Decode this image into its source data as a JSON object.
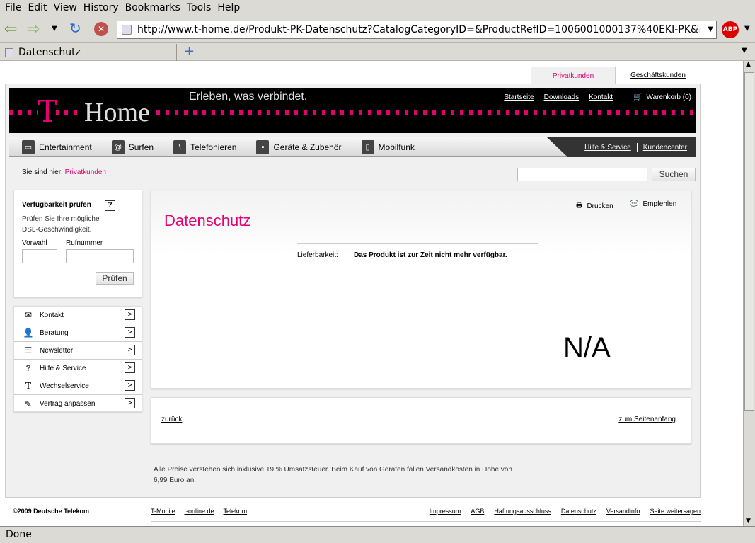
{
  "browser": {
    "menu": [
      "File",
      "Edit",
      "View",
      "History",
      "Bookmarks",
      "Tools",
      "Help"
    ],
    "url": "http://www.t-home.de/Produkt-PK-Datenschutz?CatalogCategoryID=&ProductRefID=1006001000137%40EKI-PK&",
    "tab_title": "Datenschutz",
    "status": "Done",
    "adblock": "ABP"
  },
  "site": {
    "tabs": [
      "Privatkunden",
      "Geschäftskunden"
    ],
    "logo_t": "T",
    "logo_home": "Home",
    "slogan": "Erleben, was verbindet.",
    "top_links": [
      "Startseite",
      "Downloads",
      "Kontakt"
    ],
    "cart": "Warenkorb (0)",
    "nav": [
      "Entertainment",
      "Surfen",
      "Telefonieren",
      "Geräte & Zubehör",
      "Mobilfunk"
    ],
    "nav_right": [
      "Hilfe & Service",
      "Kundencenter"
    ],
    "breadcrumb_label": "Sie sind hier:",
    "breadcrumb_item": "Privatkunden",
    "search_button": "Suchen",
    "search_value": "",
    "check": {
      "title": "Verfügbarkeit prüfen",
      "help": "?",
      "desc1": "Prüfen Sie Ihre mögliche",
      "desc2": "DSL-Geschwindigkeit.",
      "label_vorwahl": "Vorwahl",
      "label_rufnummer": "Rufnummer",
      "button": "Prüfen"
    },
    "links": [
      "Kontakt",
      "Beratung",
      "Newsletter",
      "Hilfe & Service",
      "Wechselservice",
      "Vertrag anpassen"
    ],
    "main": {
      "print": "Drucken",
      "recommend": "Empfehlen",
      "title": "Datenschutz",
      "avail_label": "Lieferbarkeit:",
      "avail_value": "Das Produkt ist zur Zeit nicht mehr verfügbar.",
      "image_placeholder": "N/A"
    },
    "back": "zurück",
    "to_top": "zum Seitenanfang",
    "note1": "Alle Preise verstehen sich inklusive 19 % Umsatzsteuer. Beim Kauf von Geräten fallen Versandkosten in Höhe von",
    "note2": "6,99 Euro an.",
    "copyright": "©2009 Deutsche Telekom",
    "footer_left": [
      "T-Mobile",
      "t-online.de",
      "Telekom"
    ],
    "footer_right": [
      "Impressum",
      "AGB",
      "Haftungsausschluss",
      "Datenschutz",
      "Versandinfo",
      "Seite weitersagen"
    ],
    "accent": "#e20074"
  }
}
